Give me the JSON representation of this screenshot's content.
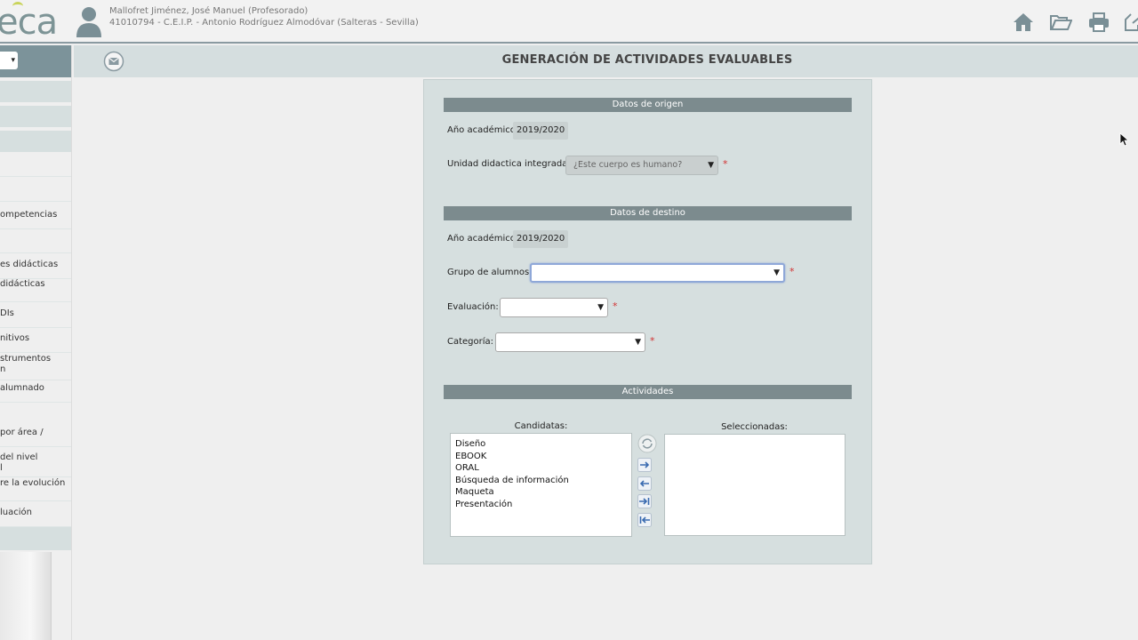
{
  "brand": {
    "logo_text": "eca"
  },
  "user": {
    "name": "Mallofret Jiménez, José Manuel (Profesorado)",
    "center": "41010794 - C.E.I.P. - Antonio Rodríguez Almodóvar (Salteras - Sevilla)"
  },
  "toolbar": {
    "icons": [
      "home-icon",
      "folder-open-icon",
      "print-icon",
      "exit-icon"
    ]
  },
  "sidebar": {
    "select_arrow": "▾",
    "items": [
      "ompetencias",
      "es didácticas",
      " didácticas",
      "DIs",
      "nitivos",
      "strumentos\nn",
      " alumnado",
      "por área /",
      "del nivel\nl",
      "re la evolución",
      "luación"
    ]
  },
  "page": {
    "title": "GENERACIÓN DE ACTIVIDADES EVALUABLES"
  },
  "origin": {
    "section_title": "Datos de origen",
    "year_label": "Año académico",
    "year_value": "2019/2020",
    "unit_label": "Unidad didactica integrada:",
    "unit_value": "¿Este cuerpo es humano?"
  },
  "destination": {
    "section_title": "Datos de destino",
    "year_label": "Año académico",
    "year_value": "2019/2020",
    "group_label": "Grupo de alumnos:",
    "group_value": "",
    "evaluation_label": "Evaluación:",
    "evaluation_value": "",
    "category_label": "Categoría:",
    "category_value": ""
  },
  "activities": {
    "section_title": "Actividades",
    "candidates_label": "Candidatas:",
    "selected_label": "Seleccionadas:",
    "candidates": [
      "Diseño",
      "EBOOK",
      "ORAL",
      "Búsqueda de información",
      "Maqueta",
      "Presentación"
    ],
    "selected": []
  },
  "required_mark": "*",
  "colors": {
    "accent": "#7c939a",
    "section_header": "#7c8b8e",
    "panel": "#d6dfdf",
    "required": "#d23232"
  }
}
